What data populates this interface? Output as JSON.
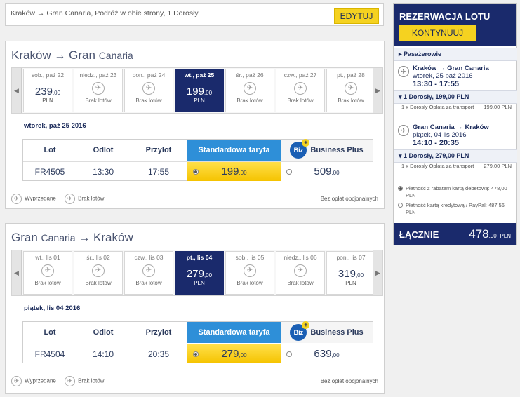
{
  "search": {
    "summary": "Kraków → Gran Canaria, Podróż w obie strony, 1 Dorosły",
    "edit_label": "EDYTUJ"
  },
  "outbound": {
    "title_from": "Kraków",
    "arrow": "→",
    "title_to_main": "Gran",
    "title_to_small": "Canaria",
    "days": [
      {
        "name": "sob., paź 22",
        "price": "239",
        "cents": ",00",
        "currency": "PLN",
        "available": true,
        "selected": false
      },
      {
        "name": "niedz., paź 23",
        "no_flights": "Brak lotów",
        "available": false,
        "selected": false
      },
      {
        "name": "pon., paź 24",
        "no_flights": "Brak lotów",
        "available": false,
        "selected": false
      },
      {
        "name": "wt., paź 25",
        "price": "199",
        "cents": ",00",
        "currency": "PLN",
        "available": true,
        "selected": true
      },
      {
        "name": "śr., paź 26",
        "no_flights": "Brak lotów",
        "available": false,
        "selected": false
      },
      {
        "name": "czw., paź 27",
        "no_flights": "Brak lotów",
        "available": false,
        "selected": false
      },
      {
        "name": "pt., paź 28",
        "no_flights": "Brak lotów",
        "available": false,
        "selected": false
      }
    ],
    "date_label": "wtorek, paź 25 2016",
    "table": {
      "h_flight": "Lot",
      "h_dep": "Odlot",
      "h_arr": "Przylot",
      "h_std": "Standardowa taryfa",
      "h_plus": "Business Plus",
      "biz_logo": "Biz",
      "flight": "FR4505",
      "dep": "13:30",
      "arr": "17:55",
      "std_price": "199",
      "std_cents": ",00",
      "plus_price": "509",
      "plus_cents": ",00"
    }
  },
  "return": {
    "title_from_main": "Gran",
    "title_from_small": "Canaria",
    "arrow": "→",
    "title_to": "Kraków",
    "days": [
      {
        "name": "wt., lis 01",
        "no_flights": "Brak lotów",
        "available": false,
        "selected": false
      },
      {
        "name": "śr., lis 02",
        "no_flights": "Brak lotów",
        "available": false,
        "selected": false
      },
      {
        "name": "czw., lis 03",
        "no_flights": "Brak lotów",
        "available": false,
        "selected": false
      },
      {
        "name": "pt., lis 04",
        "price": "279",
        "cents": ",00",
        "currency": "PLN",
        "available": true,
        "selected": true
      },
      {
        "name": "sob., lis 05",
        "no_flights": "Brak lotów",
        "available": false,
        "selected": false
      },
      {
        "name": "niedz., lis 06",
        "no_flights": "Brak lotów",
        "available": false,
        "selected": false
      },
      {
        "name": "pon., lis 07",
        "price": "319",
        "cents": ",00",
        "currency": "PLN",
        "available": true,
        "selected": false
      }
    ],
    "date_label": "piątek, lis 04 2016",
    "table": {
      "h_flight": "Lot",
      "h_dep": "Odlot",
      "h_arr": "Przylot",
      "h_std": "Standardowa taryfa",
      "h_plus": "Business Plus",
      "biz_logo": "Biz",
      "flight": "FR4504",
      "dep": "14:10",
      "arr": "20:35",
      "std_price": "279",
      "std_cents": ",00",
      "plus_price": "639",
      "plus_cents": ",00"
    }
  },
  "legend": {
    "sold_out": "Wyprzedane",
    "no_flights": "Brak lotów",
    "no_fees": "Bez opłat opcjonalnych"
  },
  "sidebar": {
    "title": "REZERWACJA LOTU",
    "continue_label": "KONTYNUUJ",
    "passengers_label": "▸ Pasażerowie",
    "out_route": "Kraków → Gran Canaria",
    "out_date": "wtorek, 25 paź 2016",
    "out_times": "13:30 - 17:55",
    "out_pax": "▾ 1 Dorosły, 199,00 PLN",
    "out_fee": "1 x Dorosły Opłata za transport",
    "out_fee_amt": "199,00 PLN",
    "ret_route": "Gran Canaria → Kraków",
    "ret_date": "piątek, 04 lis 2016",
    "ret_times": "14:10 - 20:35",
    "ret_pax": "▾ 1 Dorosły, 279,00 PLN",
    "ret_fee": "1 x Dorosły Opłata za transport",
    "ret_fee_amt": "279,00 PLN",
    "pay_debit": "Płatność z rabatem kartą debetową: 478,00 PLN",
    "pay_credit": "Płatność kartą kredytową / PayPal: 487,56 PLN",
    "total_label": "ŁĄCZNIE",
    "total_value": "478",
    "total_cents": ",00",
    "total_currency": "PLN"
  },
  "icons": {
    "plane": "✈",
    "nav_left": "◀",
    "nav_right": "▶",
    "sold_out": "✈",
    "flight_sidebar": "✈"
  },
  "colors": {
    "brand_navy": "#1a2a6c",
    "accent_yellow": "#f5d220",
    "std_blue": "#2e8fd8"
  }
}
